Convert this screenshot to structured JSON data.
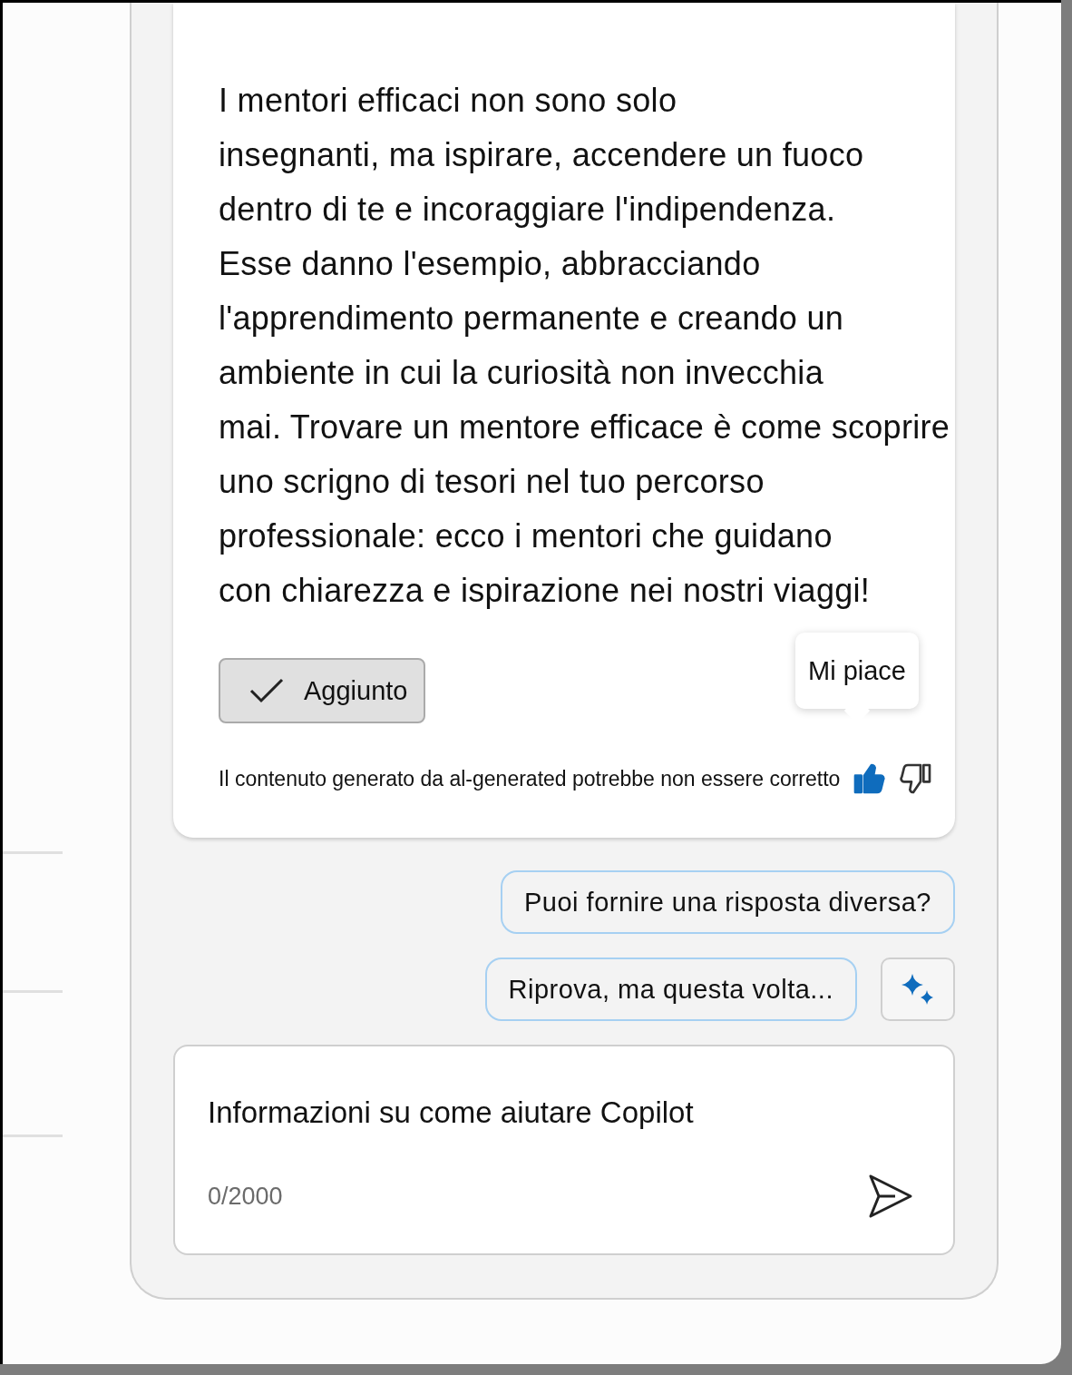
{
  "message": {
    "paragraph_lines": [
      "I mentori efficaci non sono solo",
      "insegnanti, ma ispirare, accendere un fuoco",
      "dentro di te e incoraggiare l'indipendenza.",
      "Esse danno l'esempio, abbracciando",
      "l'apprendimento permanente e creando un",
      "ambiente in cui la curiosità non invecchia",
      "mai. Trovare un mentore efficace è come scoprire",
      "uno scrigno di tesori nel tuo percorso",
      "professionale: ecco i mentori che guidano",
      "con chiarezza e ispirazione nei nostri viaggi!"
    ],
    "added_button": {
      "label": "Aggiunto",
      "checked": true
    },
    "tooltip": "Mi piace",
    "disclaimer": "Il contenuto generato da al-generated potrebbe non essere corretto",
    "thumbs_up": {
      "selected": true
    },
    "thumbs_down": {
      "selected": false
    }
  },
  "suggestions": [
    {
      "label": "Puoi fornire una risposta diversa?"
    },
    {
      "label": "Riprova, ma questa volta..."
    }
  ],
  "input": {
    "placeholder": "Informazioni su come aiutare Copilot",
    "counter": "0/2000"
  }
}
